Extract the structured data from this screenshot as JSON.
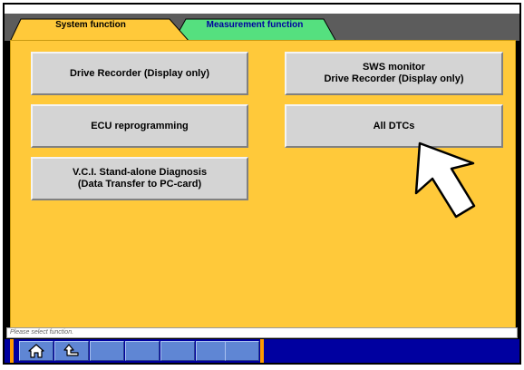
{
  "tabs": [
    {
      "label": "System function",
      "color": "#ffc93a",
      "active": true
    },
    {
      "label": "Measurement function",
      "color": "#55e07f",
      "active": false
    }
  ],
  "buttons": {
    "drive_recorder": "Drive Recorder (Display only)",
    "sws_monitor": "SWS monitor\nDrive Recorder (Display only)",
    "ecu_reprogramming": "ECU reprogramming",
    "all_dtcs": "All DTCs",
    "vci_standalone": "V.C.I. Stand-alone Diagnosis\n(Data Transfer to PC-card)"
  },
  "status": {
    "text": "Please select function."
  },
  "toolbar": {
    "icons": [
      "home-icon",
      "back-arrow-icon"
    ]
  },
  "colors": {
    "panel": "#ffc93a",
    "toolbar": "#0000a0",
    "toolbar_button": "#5f86d4",
    "accent_orange": "#ff9b00",
    "button_face": "#d4d4d4"
  }
}
